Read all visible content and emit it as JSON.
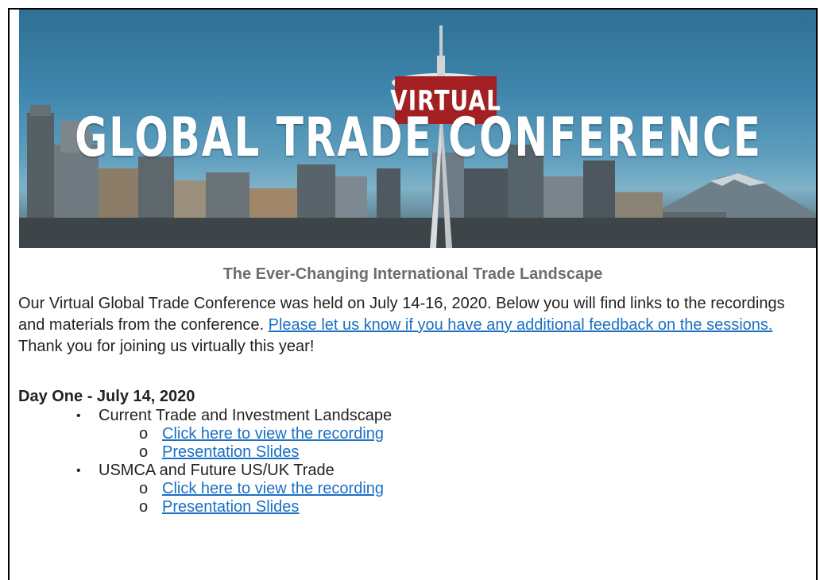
{
  "banner": {
    "badge": "VIRTUAL",
    "title": "GLOBAL TRADE CONFERENCE"
  },
  "subtitle": "The Ever-Changing International Trade Landscape",
  "intro": {
    "text_before": "Our Virtual Global Trade Conference was held on July 14-16, 2020. Below you will find links to the recordings and materials from the conference. ",
    "feedback_link": "Please let us know if you have any additional feedback on the sessions.",
    "text_after": " Thank you for joining us virtually this year!"
  },
  "day_one": {
    "heading": "Day One - July 14, 2020",
    "sessions": [
      {
        "title": "Current Trade and Investment Landscape",
        "links": [
          "Click here to view the recording",
          "Presentation Slides"
        ]
      },
      {
        "title": "USMCA and Future US/UK Trade",
        "links": [
          "Click here to view the recording",
          "Presentation Slides"
        ]
      }
    ]
  },
  "colors": {
    "link": "#1a6fc4",
    "badge": "#a32022",
    "subtitle": "#6d6d6d"
  },
  "icons": {
    "level1_bullet": "bullet-dot-icon",
    "level2_bullet": "circle-bullet-icon"
  }
}
